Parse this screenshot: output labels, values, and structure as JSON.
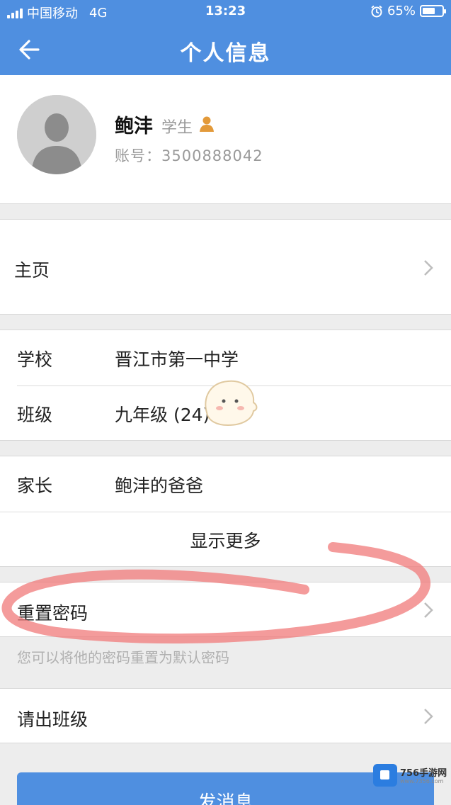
{
  "status_bar": {
    "carrier": "中国移动",
    "network": "4G",
    "time": "13:23",
    "battery": "65%",
    "battery_level": 0.65
  },
  "nav": {
    "title": "个人信息",
    "back_icon": "arrow-left-icon"
  },
  "profile": {
    "name": "鲍沣",
    "role": "学生",
    "account_label": "账号：",
    "account_number": "3500888042"
  },
  "home_row": {
    "label": "主页"
  },
  "school_section": {
    "school_label": "学校",
    "school_value": "晋江市第一中学",
    "class_label": "班级",
    "class_value": "九年级 (24) 班"
  },
  "parent_section": {
    "parent_label": "家长",
    "parent_value": "鲍沣的爸爸",
    "show_more": "显示更多"
  },
  "reset_row": {
    "label": "重置密码"
  },
  "reset_hint": "您可以将他的密码重置为默认密码",
  "leave_class_row": {
    "label": "请出班级"
  },
  "send_button": {
    "label": "发消息"
  },
  "watermark": {
    "brand": "756手游网",
    "domain": "www.7356.com"
  },
  "colors": {
    "accent": "#4f8fe0",
    "annotation": "#f07a7a"
  }
}
